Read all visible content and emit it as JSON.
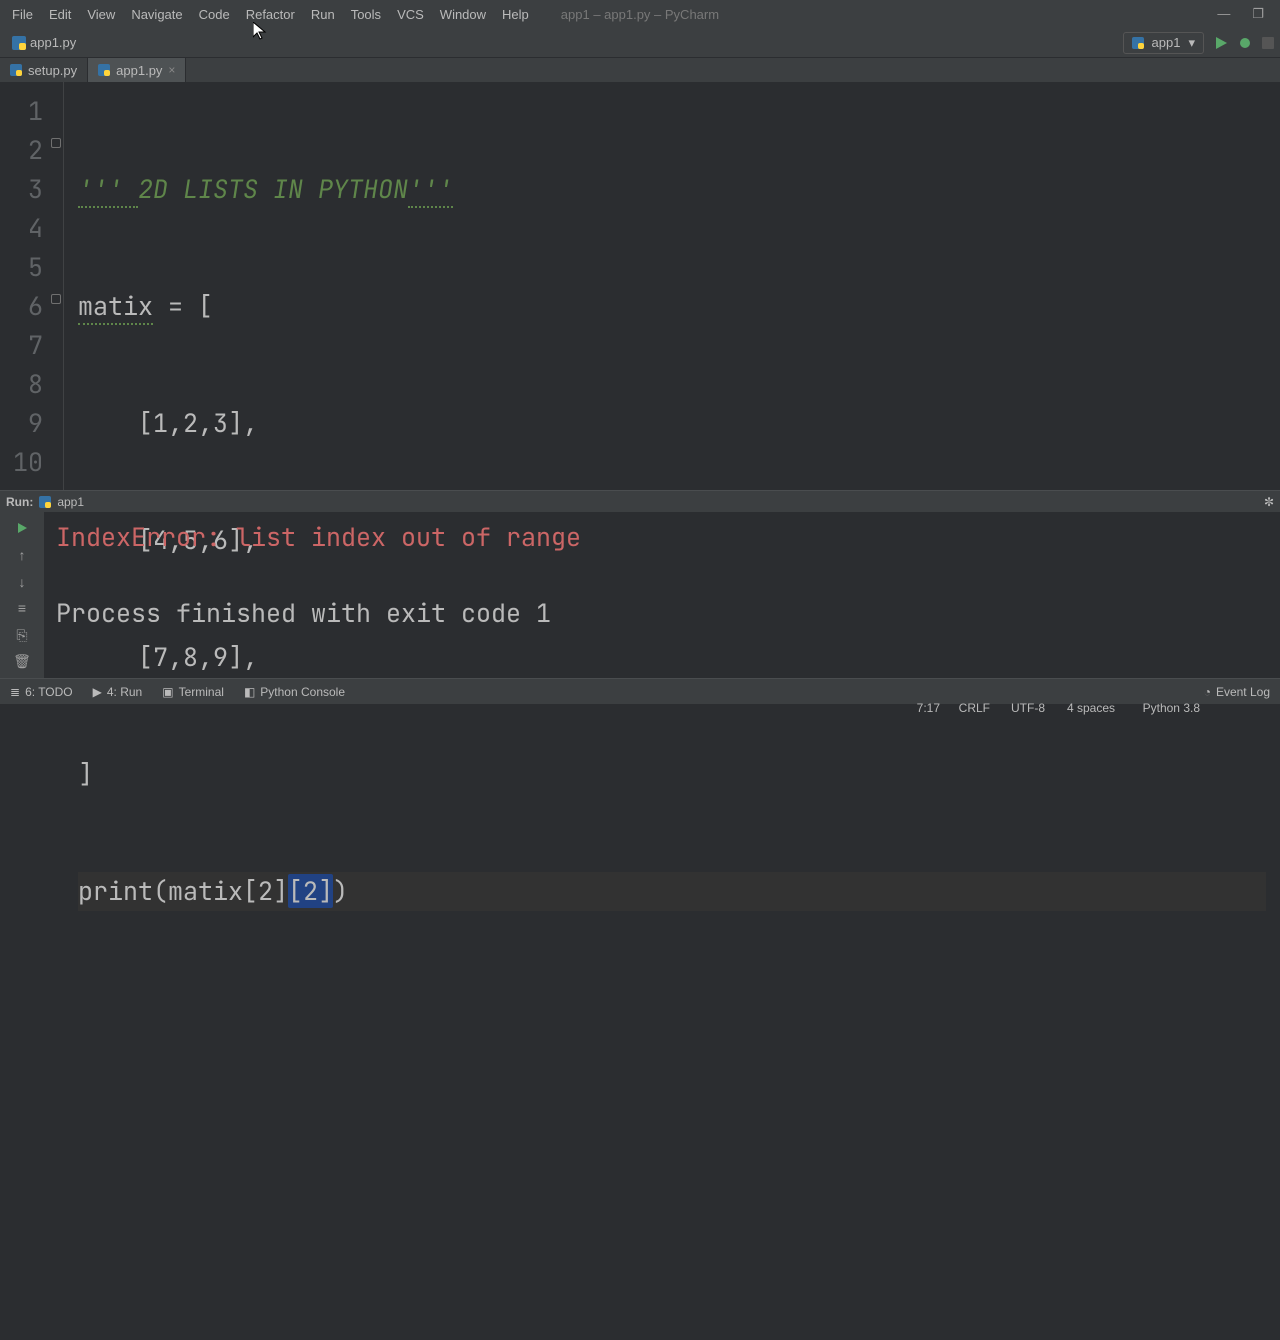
{
  "menu": {
    "items": [
      "File",
      "Edit",
      "View",
      "Navigate",
      "Code",
      "Refactor",
      "Run",
      "Tools",
      "VCS",
      "Window",
      "Help"
    ],
    "title": "app1 – app1.py – PyCharm"
  },
  "win": {
    "min": "—",
    "max": "❐",
    "close": "✕"
  },
  "nav": {
    "breadcrumb": "app1.py",
    "run_config": "app1"
  },
  "tabs": [
    {
      "label": "setup.py",
      "active": false
    },
    {
      "label": "app1.py",
      "active": true
    }
  ],
  "editor": {
    "lines": [
      {
        "n": "1"
      },
      {
        "n": "2"
      },
      {
        "n": "3"
      },
      {
        "n": "4"
      },
      {
        "n": "5"
      },
      {
        "n": "6"
      },
      {
        "n": "7"
      },
      {
        "n": "8"
      },
      {
        "n": "9"
      },
      {
        "n": "10"
      }
    ],
    "code": {
      "l1_open": "''' ",
      "l1_text": "2D LISTS IN PYTHON",
      "l1_close": "'''",
      "l2_var": "matix",
      "l2_rest": " = [",
      "l3": "    [1,2,3],",
      "l4": "    [4,5,6],",
      "l5": "    [7,8,9],",
      "l6": "]",
      "l7_pre": "print(matix[2]",
      "l7_hl": "[2]",
      "l7_post": ")"
    }
  },
  "tool": {
    "title": "Run:",
    "config": "app1"
  },
  "console": {
    "error": "IndexError: list index out of range",
    "exit": "Process finished with exit code 1"
  },
  "bottom": {
    "todo": "6: TODO",
    "run": "4: Run",
    "terminal": "Terminal",
    "pyconsole": "Python Console",
    "eventlog": "Event Log",
    "pos": "7:17",
    "eol": "CRLF",
    "enc": "UTF-8",
    "indent": "4 spaces",
    "python": "Python 3.8"
  }
}
